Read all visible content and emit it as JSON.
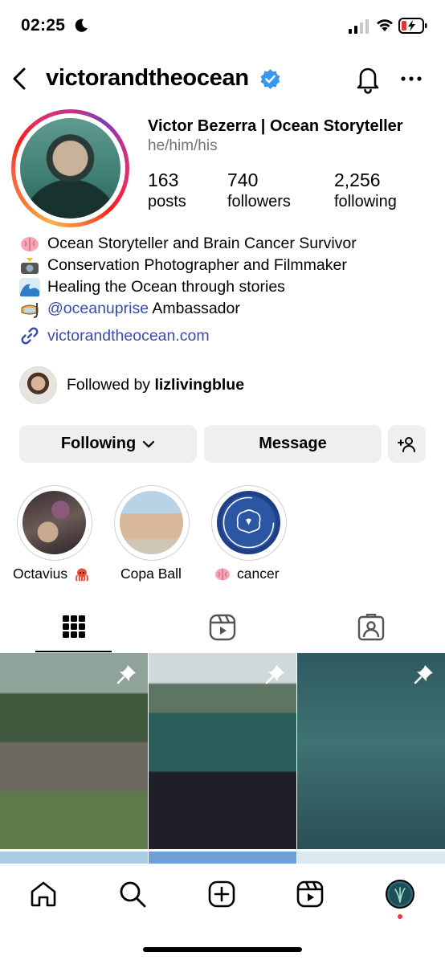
{
  "status_bar": {
    "time": "02:25"
  },
  "header": {
    "username": "victorandtheocean"
  },
  "profile": {
    "display_name": "Victor Bezerra | Ocean Storyteller",
    "pronouns": "he/him/his",
    "stats": [
      {
        "value": "163",
        "label": "posts"
      },
      {
        "value": "740",
        "label": "followers"
      },
      {
        "value": "2,256",
        "label": "following"
      }
    ],
    "bio": [
      {
        "icon": "brain-emoji",
        "text": "Ocean Storyteller and Brain Cancer Survivor"
      },
      {
        "icon": "camera-flash-emoji",
        "text": "Conservation Photographer and Filmmaker"
      },
      {
        "icon": "wave-emoji",
        "text": "Healing the Ocean through stories"
      },
      {
        "icon": "diving-mask-emoji",
        "mention": "@oceanuprise",
        "text": " Ambassador"
      }
    ],
    "link": "victorandtheocean.com",
    "followed_by_prefix": "Followed by ",
    "followed_by_user": "lizlivingblue"
  },
  "actions": {
    "following": "Following",
    "message": "Message"
  },
  "highlights": [
    {
      "label": "Octavius",
      "emoji": "octopus-emoji"
    },
    {
      "label": "Copa Ball",
      "emoji": ""
    },
    {
      "label": "cancer",
      "emoji": "brain-emoji"
    }
  ],
  "colors": {
    "link": "#3a4ba8",
    "button_bg": "#efefef",
    "notification_dot": "#ff3040"
  }
}
